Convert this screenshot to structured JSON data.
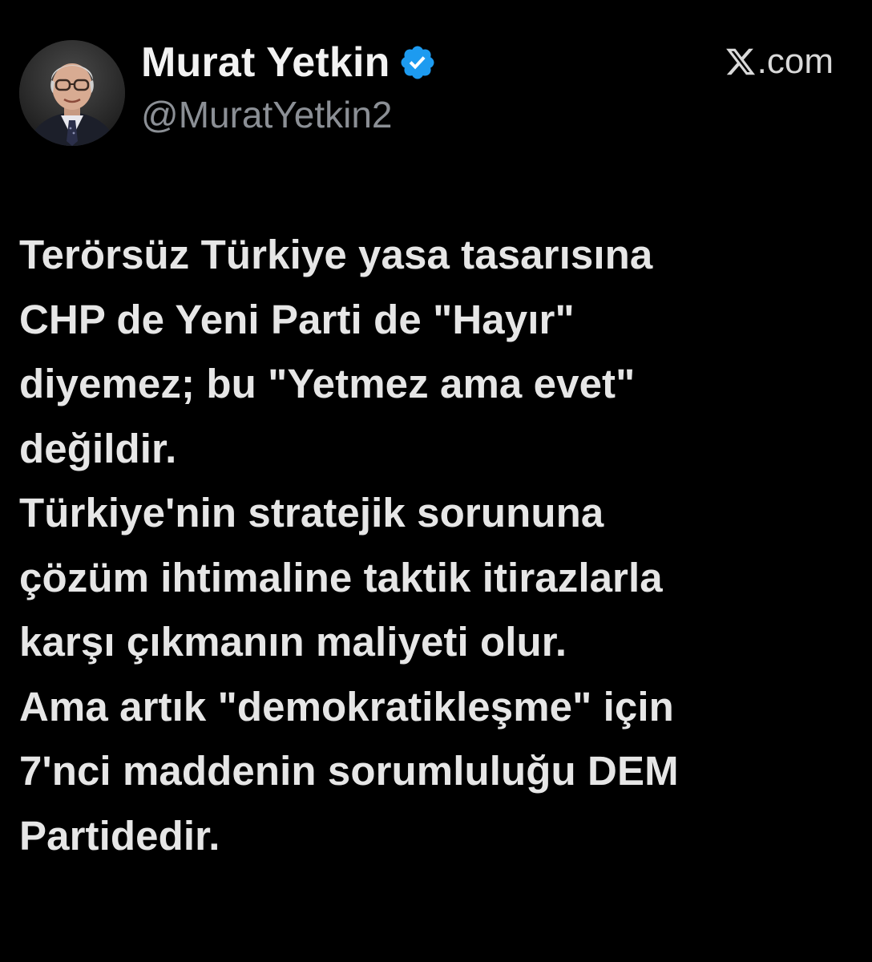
{
  "author": {
    "display_name": "Murat Yetkin",
    "handle": "@MuratYetkin2",
    "verified": true,
    "verified_color": "#1d9bf0",
    "avatar_icon": "profile-photo"
  },
  "brand": {
    "logo_icon": "x-logo-icon",
    "label": ".com"
  },
  "tweet": {
    "lines": [
      "Terörsüz Türkiye yasa tasarısına",
      "CHP de Yeni Parti de \"Hayır\"",
      "diyemez; bu \"Yetmez ama evet\"",
      "değildir.",
      "Türkiye'nin stratejik sorununa",
      "çözüm ihtimaline taktik itirazlarla",
      "karşı çıkmanın maliyeti olur.",
      "Ama artık \"demokratikleşme\" için",
      "7'nci maddenin sorumluluğu DEM",
      "Partidedir."
    ]
  },
  "colors": {
    "background": "#000000",
    "text": "#e6e6e6",
    "handle": "#8b8f95"
  }
}
